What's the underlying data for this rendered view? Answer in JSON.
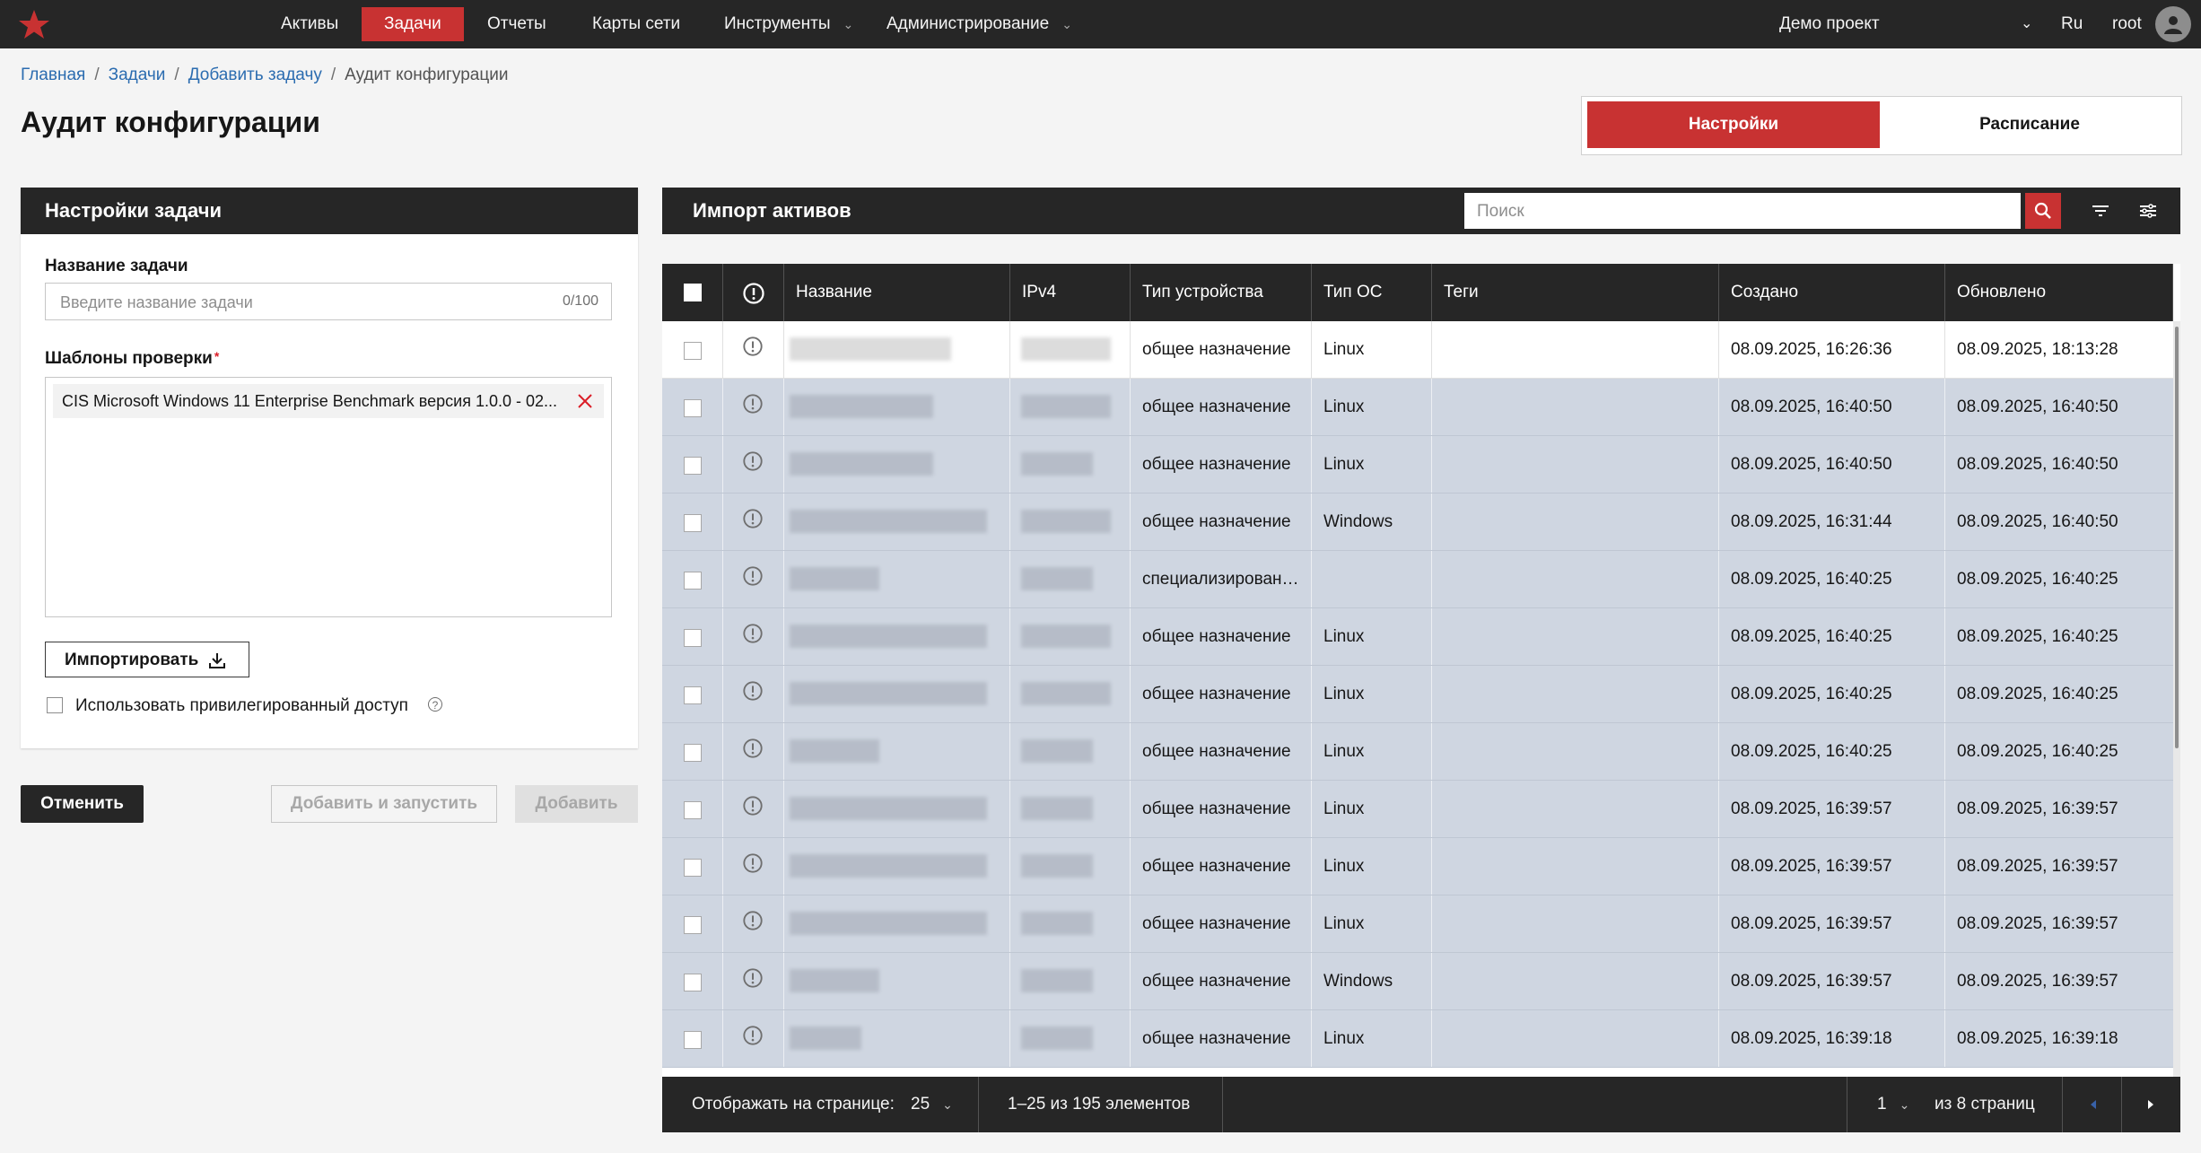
{
  "nav": {
    "items": [
      "Активы",
      "Задачи",
      "Отчеты",
      "Карты сети",
      "Инструменты",
      "Администрирование"
    ],
    "active_item": "Задачи",
    "project": "Демо проект",
    "language": "Ru",
    "user": "root"
  },
  "breadcrumb": [
    "Главная",
    "Задачи",
    "Добавить задачу",
    "Аудит конфигурации"
  ],
  "page_title": "Аудит конфигурации",
  "tabs": [
    "Настройки",
    "Расписание"
  ],
  "task_settings": {
    "header": "Настройки задачи",
    "name_label": "Название задачи",
    "name_placeholder": "Введите название задачи",
    "name_value": "",
    "name_counter": "0/100",
    "templates_label": "Шаблоны проверки",
    "required_mark": "*",
    "templates": [
      "CIS Microsoft Windows 11 Enterprise Benchmark версия 1.0.0 - 02..."
    ],
    "import_button": "Импортировать",
    "privileged_label": "Использовать привилегированный доступ",
    "privileged_checked": false,
    "help_glyph": "?"
  },
  "actions": {
    "cancel": "Отменить",
    "add_and_run": "Добавить и запустить",
    "add": "Добавить"
  },
  "assets": {
    "header": "Импорт активов",
    "search_placeholder": "Поиск",
    "columns": [
      "Название",
      "IPv4",
      "Тип устройства",
      "Тип ОС",
      "Теги",
      "Создано",
      "Обновлено"
    ],
    "rows": [
      {
        "device_type": "общее назначение",
        "os": "Linux",
        "created": "08.09.2025, 16:26:36",
        "updated": "08.09.2025, 18:13:28",
        "selected": false
      },
      {
        "device_type": "общее назначение",
        "os": "Linux",
        "created": "08.09.2025, 16:40:50",
        "updated": "08.09.2025, 16:40:50",
        "selected": true
      },
      {
        "device_type": "общее назначение",
        "os": "Linux",
        "created": "08.09.2025, 16:40:50",
        "updated": "08.09.2025, 16:40:50",
        "selected": true
      },
      {
        "device_type": "общее назначение",
        "os": "Windows",
        "created": "08.09.2025, 16:31:44",
        "updated": "08.09.2025, 16:40:50",
        "selected": true
      },
      {
        "device_type": "специализирован…",
        "os": "",
        "created": "08.09.2025, 16:40:25",
        "updated": "08.09.2025, 16:40:25",
        "selected": true
      },
      {
        "device_type": "общее назначение",
        "os": "Linux",
        "created": "08.09.2025, 16:40:25",
        "updated": "08.09.2025, 16:40:25",
        "selected": true
      },
      {
        "device_type": "общее назначение",
        "os": "Linux",
        "created": "08.09.2025, 16:40:25",
        "updated": "08.09.2025, 16:40:25",
        "selected": true
      },
      {
        "device_type": "общее назначение",
        "os": "Linux",
        "created": "08.09.2025, 16:40:25",
        "updated": "08.09.2025, 16:40:25",
        "selected": true
      },
      {
        "device_type": "общее назначение",
        "os": "Linux",
        "created": "08.09.2025, 16:39:57",
        "updated": "08.09.2025, 16:39:57",
        "selected": true
      },
      {
        "device_type": "общее назначение",
        "os": "Linux",
        "created": "08.09.2025, 16:39:57",
        "updated": "08.09.2025, 16:39:57",
        "selected": true
      },
      {
        "device_type": "общее назначение",
        "os": "Linux",
        "created": "08.09.2025, 16:39:57",
        "updated": "08.09.2025, 16:39:57",
        "selected": true
      },
      {
        "device_type": "общее назначение",
        "os": "Windows",
        "created": "08.09.2025, 16:39:57",
        "updated": "08.09.2025, 16:39:57",
        "selected": true
      },
      {
        "device_type": "общее назначение",
        "os": "Linux",
        "created": "08.09.2025, 16:39:18",
        "updated": "08.09.2025, 16:39:18",
        "selected": true
      }
    ]
  },
  "pagination": {
    "per_page_label": "Отображать на странице:",
    "per_page": "25",
    "range": "1–25 из 195 элементов",
    "page": "1",
    "pages_label": "из 8 страниц"
  },
  "colors": {
    "accent": "#c83232",
    "dark": "#262626",
    "selected_row": "#cfd6e1"
  }
}
